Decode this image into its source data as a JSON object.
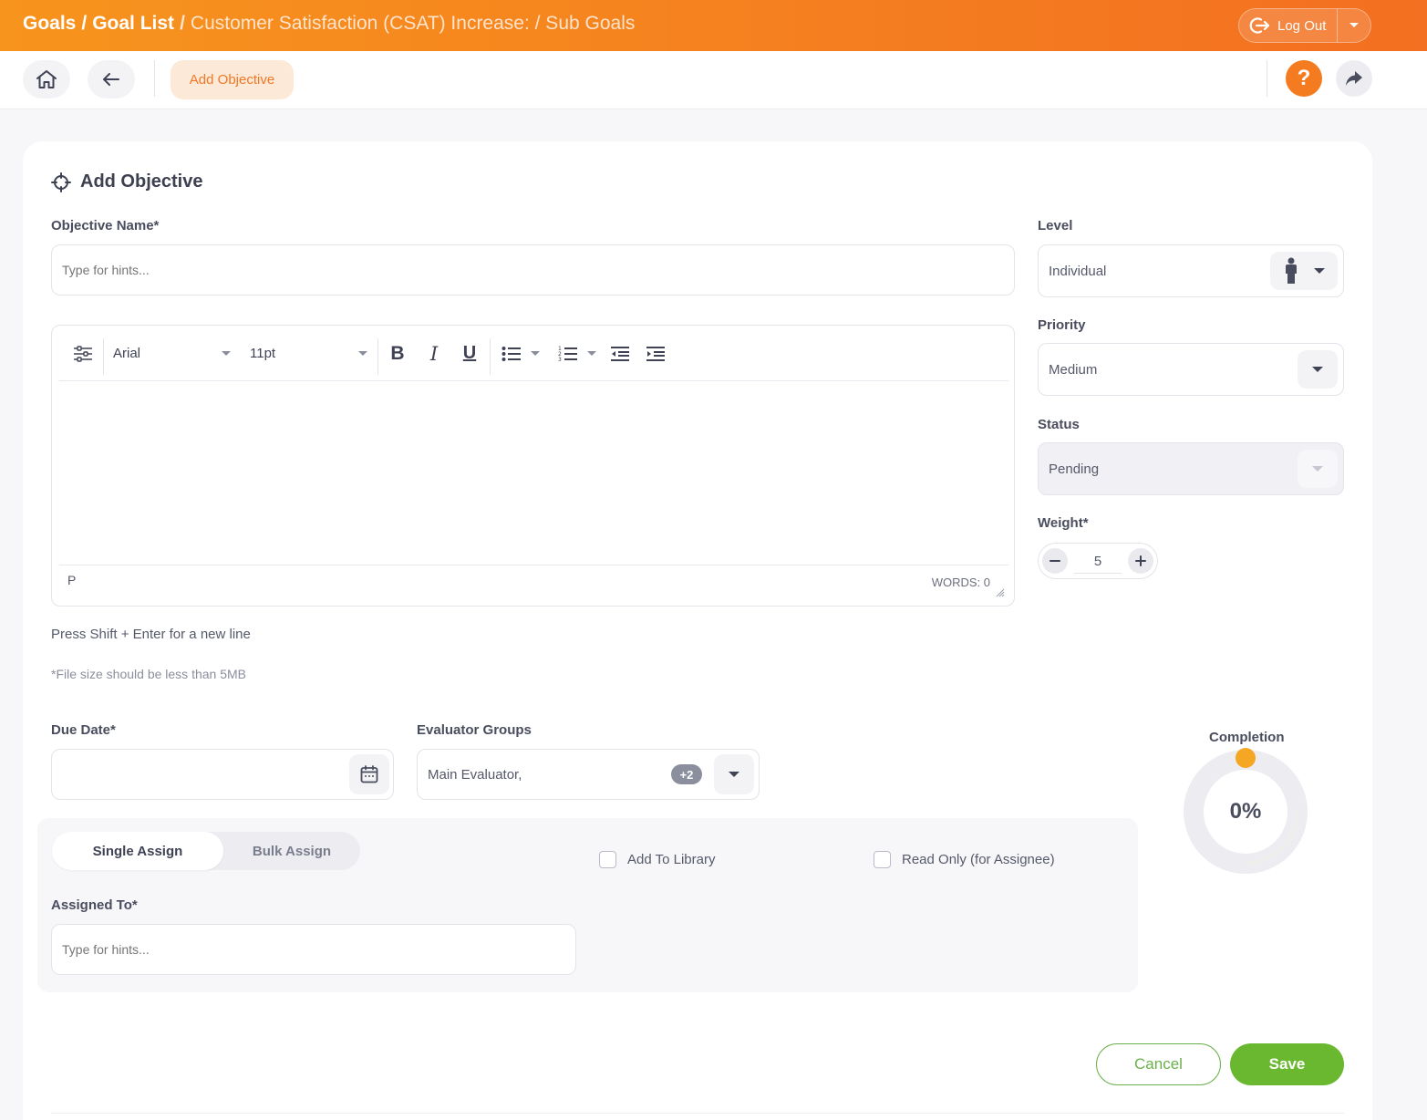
{
  "header": {
    "crumb_goals": "Goals",
    "crumb_goal_list": "Goal List",
    "crumb_current": "Customer Satisfaction (CSAT) Increase: / Sub Goals",
    "logout_label": "Log Out"
  },
  "toolbar": {
    "add_objective_tab": "Add Objective",
    "help_label": "?"
  },
  "form": {
    "title": "Add Objective",
    "objective_name_label": "Objective Name*",
    "objective_name_placeholder": "Type for hints...",
    "editor": {
      "font": "Arial",
      "size": "11pt",
      "bold": "B",
      "italic": "I",
      "underline": "U",
      "status_path": "P",
      "word_count": "WORDS: 0"
    },
    "hint_newline": "Press Shift + Enter for a new line",
    "hint_filesize": "*File size should be less than 5MB",
    "level_label": "Level",
    "level_value": "Individual",
    "priority_label": "Priority",
    "priority_value": "Medium",
    "status_label": "Status",
    "status_value": "Pending",
    "weight_label": "Weight*",
    "weight_value": "5",
    "due_date_label": "Due Date*",
    "evaluator_label": "Evaluator Groups",
    "evaluator_value": "Main Evaluator,",
    "evaluator_more": "+2",
    "single_assign": "Single Assign",
    "bulk_assign": "Bulk Assign",
    "add_to_library": "Add To Library",
    "read_only": "Read Only (for Assignee)",
    "assigned_to_label": "Assigned To*",
    "assigned_to_placeholder": "Type for hints...",
    "completion_label": "Completion",
    "completion_value": "0%",
    "completion_fraction": 0,
    "cancel_label": "Cancel",
    "save_label": "Save"
  },
  "colors": {
    "header_start": "#f7941d",
    "header_end": "#f36f21",
    "accent_orange": "#f47b20",
    "save_green": "#6ab82f",
    "knob_orange": "#f5a623"
  },
  "icons": {
    "home": "home-icon",
    "back": "arrow-left-icon",
    "help": "question-icon",
    "share": "share-icon",
    "logout": "logout-icon",
    "target": "crosshair-icon",
    "person": "person-icon",
    "calendar": "calendar-icon"
  }
}
